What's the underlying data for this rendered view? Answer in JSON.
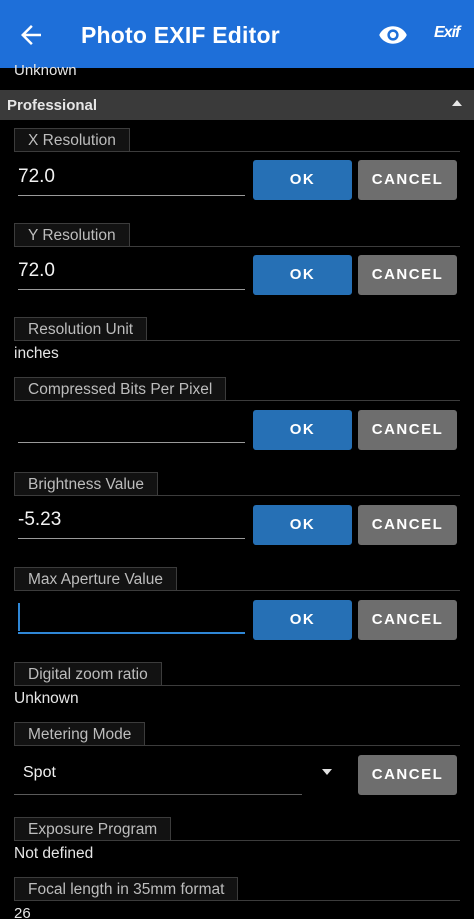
{
  "appbar": {
    "title": "Photo EXIF Editor",
    "back_icon": "arrow-left-icon",
    "preview_icon": "eye-icon",
    "exif_label": "Exif",
    "accent_color": "#1e6fd9"
  },
  "partial_top_value": "Unknown",
  "section": {
    "label": "Professional"
  },
  "buttons": {
    "ok": "OK",
    "cancel": "CANCEL"
  },
  "fields": {
    "x_resolution": {
      "label": "X Resolution",
      "value": "72.0"
    },
    "y_resolution": {
      "label": "Y Resolution",
      "value": "72.0"
    },
    "resolution_unit": {
      "label": "Resolution Unit",
      "value": "inches"
    },
    "compressed_bits": {
      "label": "Compressed Bits Per Pixel",
      "value": ""
    },
    "brightness": {
      "label": "Brightness Value",
      "value": "-5.23"
    },
    "max_aperture": {
      "label": "Max Aperture Value",
      "value": ""
    },
    "digital_zoom": {
      "label": "Digital zoom ratio",
      "value": "Unknown"
    },
    "metering_mode": {
      "label": "Metering Mode",
      "value": "Spot"
    },
    "exposure_program": {
      "label": "Exposure Program",
      "value": "Not defined"
    },
    "focal_length_35mm": {
      "label": "Focal length in 35mm format",
      "value": "26"
    }
  }
}
